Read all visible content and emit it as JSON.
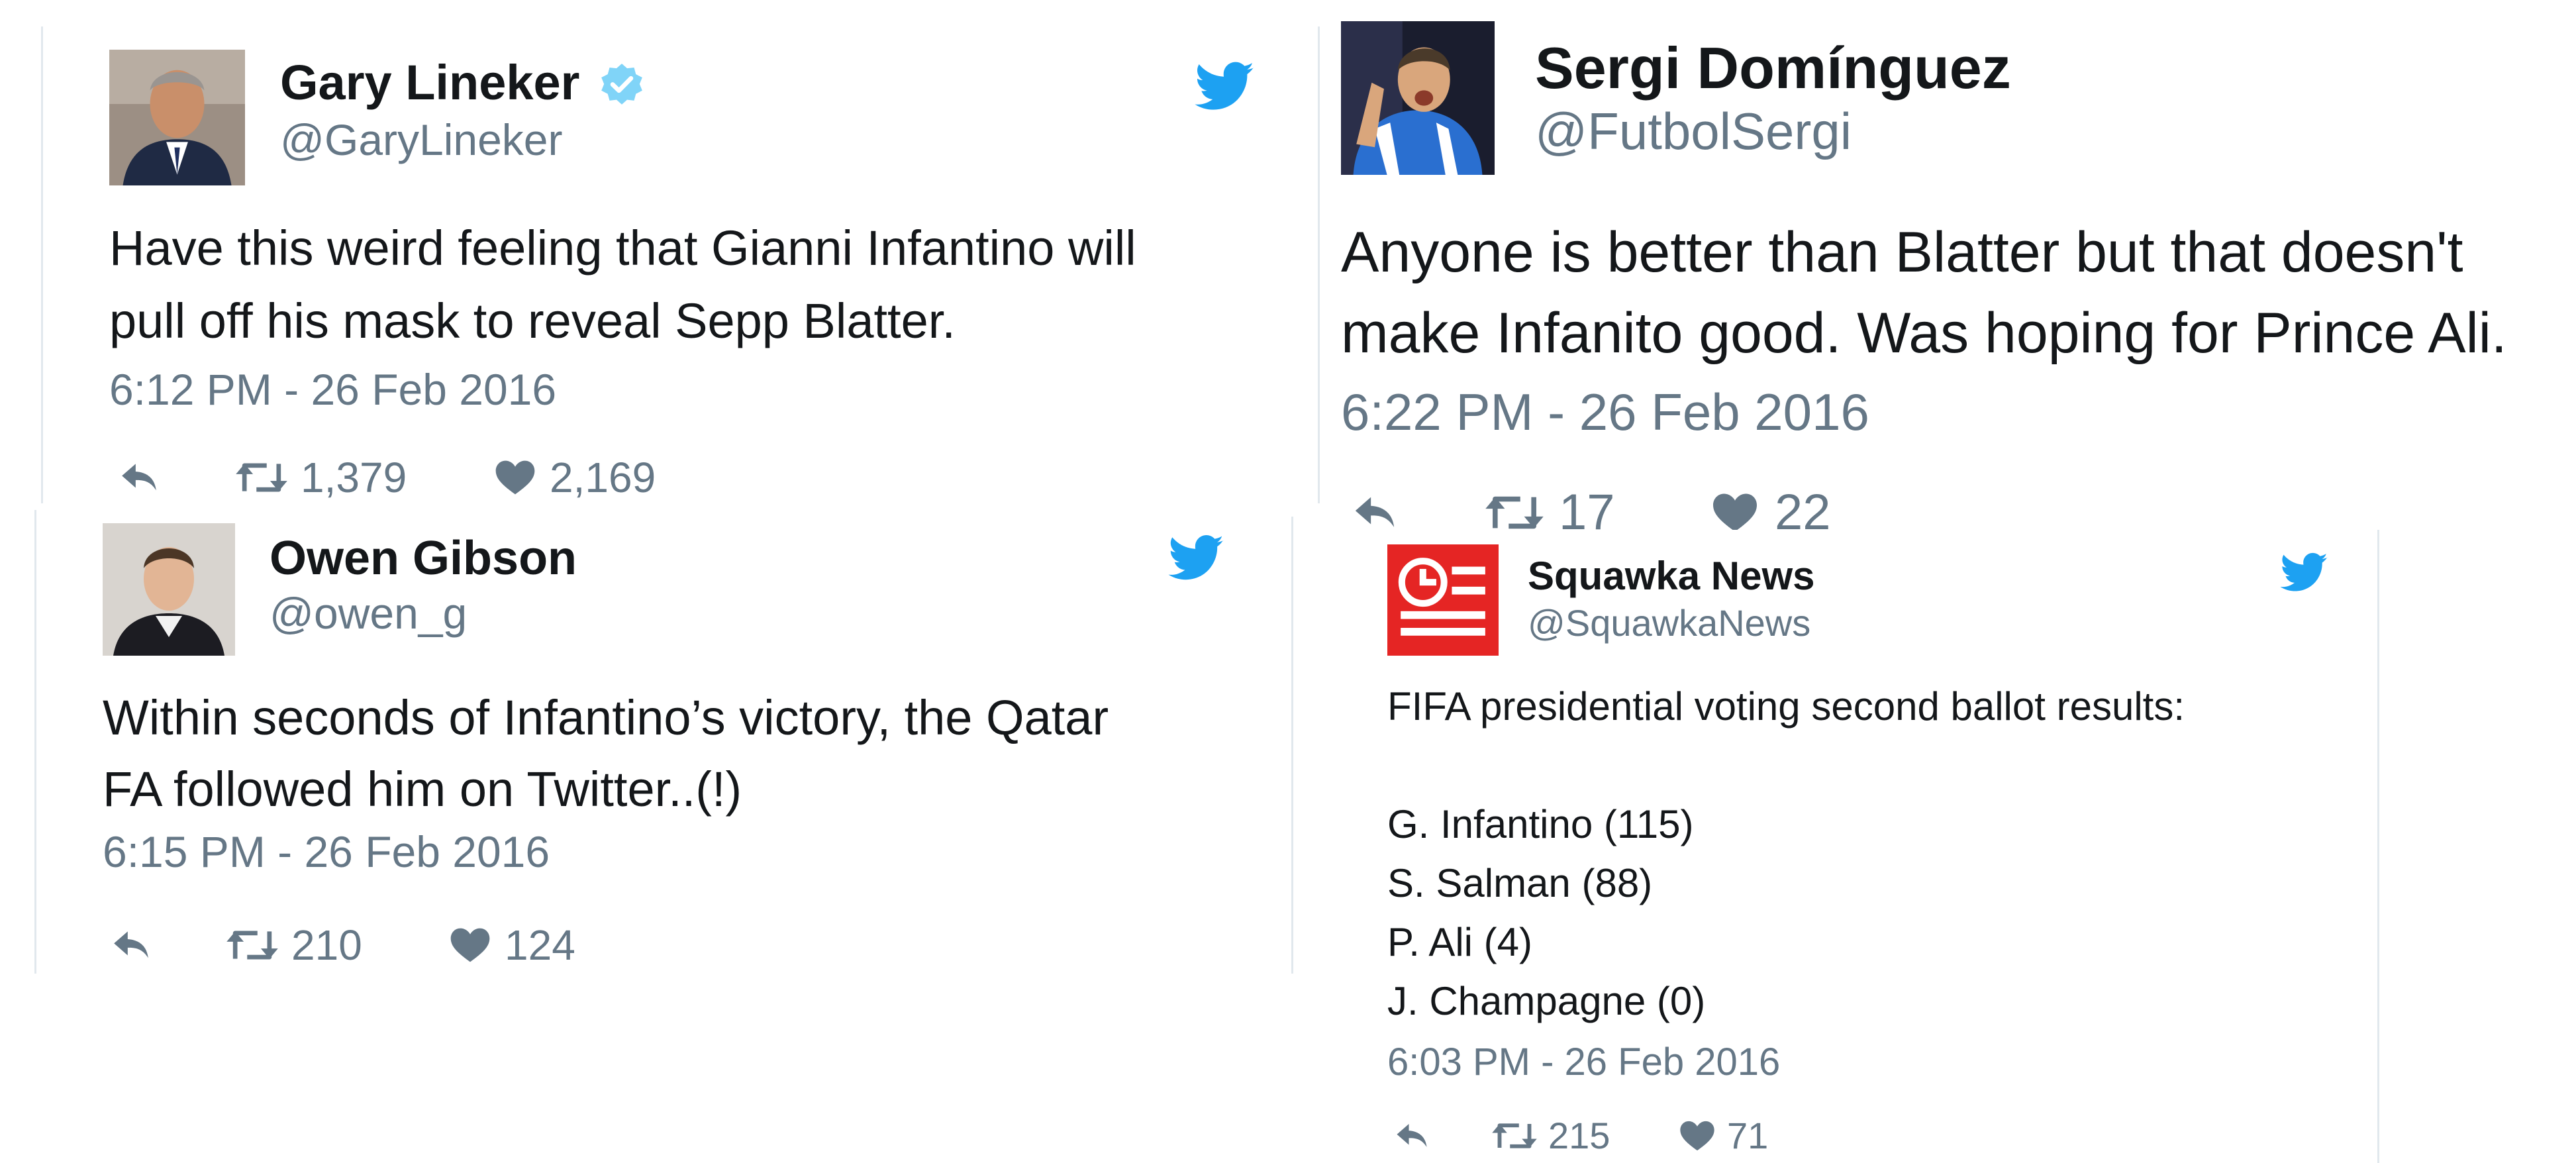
{
  "tweets": [
    {
      "name": "Gary Lineker",
      "handle": "@GaryLineker",
      "verified": true,
      "text": "Have this weird feeling that Gianni Infantino will\npull off his mask to reveal Sepp Blatter.",
      "time": "6:12 PM - 26 Feb 2016",
      "retweets": "1,379",
      "likes": "2,169"
    },
    {
      "name": "Sergi Domínguez",
      "handle": "@FutbolSergi",
      "verified": false,
      "text": "Anyone is better than Blatter but that doesn't\nmake Infanito good. Was hoping for Prince Ali.",
      "time": "6:22 PM - 26 Feb 2016",
      "retweets": "17",
      "likes": "22"
    },
    {
      "name": "Owen Gibson",
      "handle": "@owen_g",
      "verified": false,
      "text": "Within seconds of Infantino’s victory, the Qatar\nFA followed him on Twitter..(!)",
      "time": "6:15 PM - 26 Feb 2016",
      "retweets": "210",
      "likes": "124"
    },
    {
      "name": "Squawka News",
      "handle": "@SquawkaNews",
      "verified": false,
      "text": "FIFA presidential voting second ballot results:",
      "results": [
        "G. Infantino (115)",
        "S. Salman (88)",
        "P. Ali (4)",
        "J. Champagne (0)"
      ],
      "time": "6:03 PM - 26 Feb 2016",
      "retweets": "215",
      "likes": "71"
    }
  ],
  "icons": {
    "reply": "reply-icon",
    "retweet": "retweet-icon",
    "like": "heart-icon",
    "bird": "twitter-bird-icon",
    "verified": "verified-badge-icon"
  },
  "colors": {
    "twitter_blue": "#1da1f2",
    "verified_blue": "#80d4f8",
    "muted": "#657786",
    "text": "#14171a",
    "squawka_red": "#e52524"
  }
}
